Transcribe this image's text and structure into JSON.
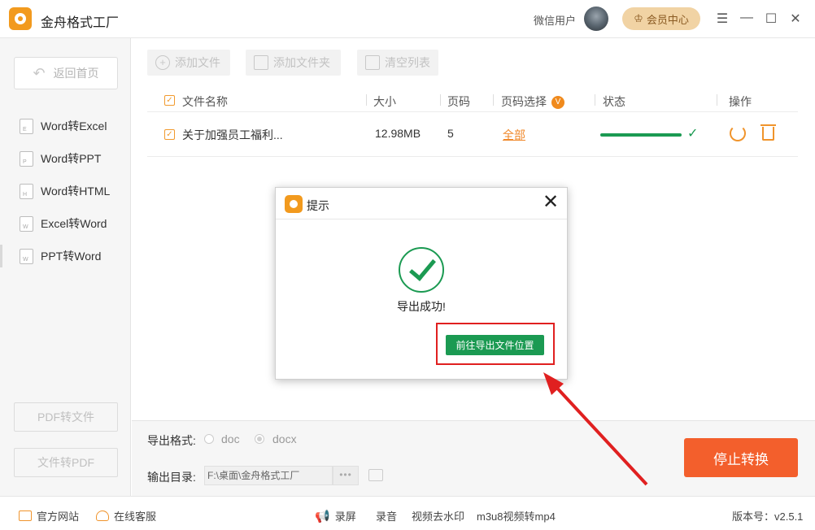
{
  "titlebar": {
    "app_title": "金舟格式工厂",
    "user_name": "微信用户",
    "vip_label": "会员中心",
    "menu_glyph": "☰",
    "minimize_glyph": "—",
    "maximize_glyph": "☐",
    "close_glyph": "✕"
  },
  "sidebar": {
    "home_label": "返回首页",
    "items": [
      {
        "label": "Word转Excel",
        "icon_letter": "E"
      },
      {
        "label": "Word转PPT",
        "icon_letter": "P"
      },
      {
        "label": "Word转HTML",
        "icon_letter": "H"
      },
      {
        "label": "Excel转Word",
        "icon_letter": "W"
      },
      {
        "label": "PPT转Word",
        "icon_letter": "W"
      }
    ],
    "pdf_to_file": "PDF转文件",
    "file_to_pdf": "文件转PDF"
  },
  "toolbar": {
    "add_file": "添加文件",
    "add_folder": "添加文件夹",
    "clear_list": "清空列表"
  },
  "table": {
    "headers": {
      "name": "文件名称",
      "size": "大小",
      "pages": "页码",
      "page_select": "页码选择",
      "status": "状态",
      "actions": "操作"
    },
    "page_select_badge": "V",
    "rows": [
      {
        "name": "关于加强员工福利...",
        "size": "12.98MB",
        "pages": "5",
        "page_select": "全部",
        "progress": 1.0
      }
    ]
  },
  "settings": {
    "format_label": "导出格式:",
    "formats": [
      "doc",
      "docx"
    ],
    "selected_format": "docx",
    "dir_label": "输出目录:",
    "dir_value": "F:\\桌面\\金舟格式工厂",
    "browse_label": "•••",
    "stop_button": "停止转换"
  },
  "statusbar": {
    "website": "官方网站",
    "support": "在线客服",
    "record_screen": "录屏",
    "record_audio": "录音",
    "remove_watermark": "视频去水印",
    "m3u8": "m3u8视频转mp4",
    "version": "版本号：v2.5.1"
  },
  "dialog": {
    "title": "提示",
    "close_glyph": "✕",
    "message": "导出成功!",
    "go_button": "前往导出文件位置"
  },
  "colors": {
    "accent_orange": "#f0942c",
    "success_green": "#1b9a52",
    "stop_red": "#f35f2c",
    "annotation_red": "#e02020"
  }
}
